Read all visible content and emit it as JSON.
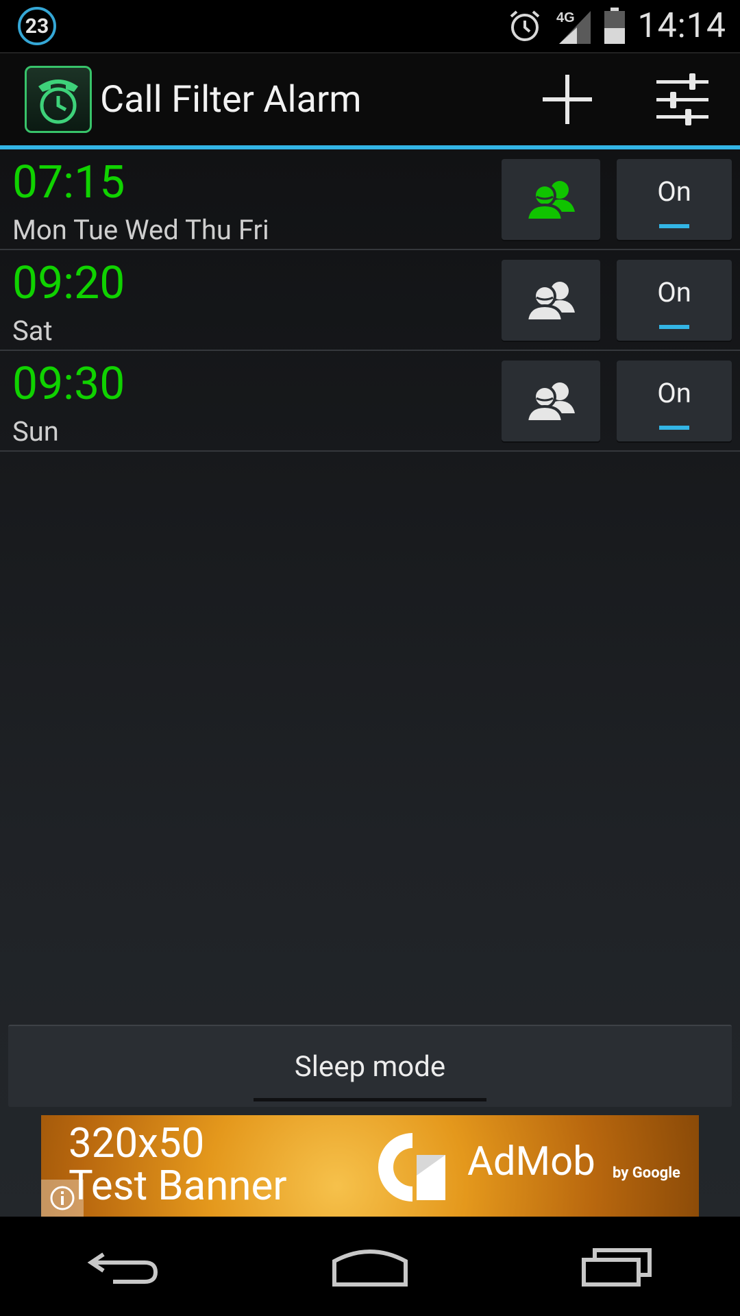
{
  "status_bar": {
    "notification_count": "23",
    "network": "4G",
    "time": "14:14"
  },
  "action_bar": {
    "title": "Call Filter Alarm",
    "add_icon": "plus-icon",
    "settings_icon": "sliders-icon"
  },
  "alarms": [
    {
      "time": "07:15",
      "days": "Mon Tue Wed Thu Fri",
      "filter_active": true,
      "toggle_label": "On"
    },
    {
      "time": "09:20",
      "days": "Sat",
      "filter_active": false,
      "toggle_label": "On"
    },
    {
      "time": "09:30",
      "days": "Sun",
      "filter_active": false,
      "toggle_label": "On"
    }
  ],
  "sleep_mode": {
    "label": "Sleep mode"
  },
  "ad": {
    "size_text": "320x50",
    "test_text": "Test Banner",
    "brand": "AdMob",
    "by_google": "by Google"
  },
  "colors": {
    "accent": "#33b5e5",
    "alarm_time": "#10d200",
    "filter_active": "#10c400",
    "filter_inactive": "#e6e6e6"
  }
}
